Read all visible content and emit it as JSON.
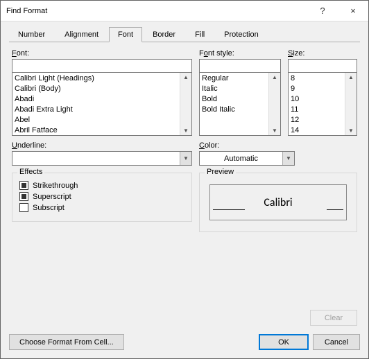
{
  "window": {
    "title": "Find Format",
    "help": "?",
    "close": "×"
  },
  "tabs": {
    "items": [
      "Number",
      "Alignment",
      "Font",
      "Border",
      "Fill",
      "Protection"
    ],
    "active": 2
  },
  "font": {
    "label": "Font:",
    "options": [
      "Calibri Light (Headings)",
      "Calibri (Body)",
      "Abadi",
      "Abadi Extra Light",
      "Abel",
      "Abril Fatface"
    ]
  },
  "fontStyle": {
    "label": "Font style:",
    "options": [
      "Regular",
      "Italic",
      "Bold",
      "Bold Italic"
    ]
  },
  "size": {
    "label": "Size:",
    "options": [
      "8",
      "9",
      "10",
      "11",
      "12",
      "14"
    ]
  },
  "underline": {
    "label": "Underline:",
    "value": ""
  },
  "color": {
    "label": "Color:",
    "value": "Automatic"
  },
  "effects": {
    "legend": "Effects",
    "strikethrough": {
      "label": "Strikethrough",
      "state": "filled"
    },
    "superscript": {
      "label": "Superscript",
      "state": "filled"
    },
    "subscript": {
      "label": "Subscript",
      "state": "empty"
    }
  },
  "preview": {
    "legend": "Preview",
    "text": "Calibri"
  },
  "buttons": {
    "clear": "Clear",
    "chooseFormat": "Choose Format From Cell...",
    "ok": "OK",
    "cancel": "Cancel"
  }
}
